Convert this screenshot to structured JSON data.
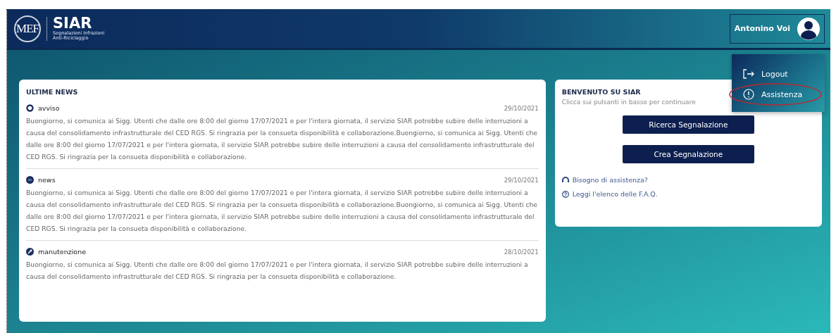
{
  "header": {
    "logo": "MEF",
    "app_name": "SIAR",
    "subtitle_lines": [
      "Segnalazioni Infrazioni",
      "Anti-Riciclaggio"
    ],
    "user_name": "Antonino Voi"
  },
  "user_menu": {
    "items": [
      {
        "kind": "logout",
        "label": "Logout",
        "highlighted": false
      },
      {
        "kind": "help",
        "label": "Assistenza",
        "highlighted": true
      }
    ]
  },
  "news": {
    "title": "ULTIME NEWS",
    "items": [
      {
        "kind": "avviso",
        "label": "avviso",
        "date": "29/10/2021",
        "text": "Buongiorno, si comunica ai Sigg. Utenti che dalle ore 8:00 del giorno 17/07/2021 e per l'intera giornata, il servizio SIAR potrebbe subire delle interruzioni a causa del consolidamento infrastrutturale del CED RGS. Si ringrazia per la consueta disponibilità e collaborazione.Buongiorno, si comunica ai Sigg. Utenti che dalle ore 8:00 del giorno 17/07/2021 e per l'intera giornata, il servizio SIAR potrebbe subire delle interruzioni a causa del consolidamento infrastrutturale del CED RGS. Si ringrazia per la consueta disponibilità e collaborazione."
      },
      {
        "kind": "news",
        "label": "news",
        "date": "29/10/2021",
        "text": "Buongiorno, si comunica ai Sigg. Utenti che dalle ore 8:00 del giorno 17/07/2021 e per l'intera giornata, il servizio SIAR potrebbe subire delle interruzioni a causa del consolidamento infrastrutturale del CED RGS. Si ringrazia per la consueta disponibilità e collaborazione.Buongiorno, si comunica ai Sigg. Utenti che dalle ore 8:00 del giorno 17/07/2021 e per l'intera giornata, il servizio SIAR potrebbe subire delle interruzioni a causa del consolidamento infrastrutturale del CED RGS. Si ringrazia per la consueta disponibilità e collaborazione."
      },
      {
        "kind": "manutenzione",
        "label": "manutenzione",
        "date": "28/10/2021",
        "text": "Buongiorno, si comunica ai Sigg. Utenti che dalle ore 8:00 del giorno 17/07/2021 e per l'intera giornata, il servizio SIAR potrebbe subire delle interruzioni a causa del consolidamento infrastrutturale del CED RGS. Si ringrazia per la consueta disponibilità e collaborazione."
      }
    ]
  },
  "welcome": {
    "title": "BENVENUTO SU SIAR",
    "subtitle": "Clicca sui pulsanti in basso per continuare",
    "buttons": [
      "Ricerca Segnalazione",
      "Crea Segnalazione"
    ],
    "links": [
      {
        "kind": "assistance",
        "label": "Bisogno di assistenza?"
      },
      {
        "kind": "faq",
        "label": "Leggi l'elenco delle F.A.Q."
      }
    ]
  }
}
